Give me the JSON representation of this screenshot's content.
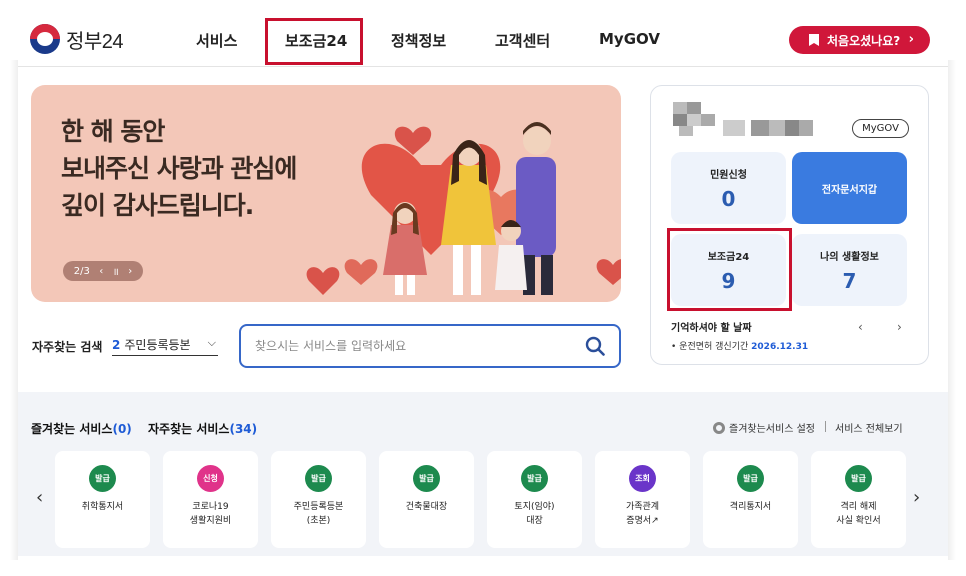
{
  "header": {
    "logo_text": "정부24",
    "nav": [
      "서비스",
      "보조금24",
      "정책정보",
      "고객센터",
      "MyGOV"
    ],
    "cta_label": "처음오셨나요?",
    "cta_arrow": "›"
  },
  "banner": {
    "title": "한 해 동안\n보내주신 사랑과 관심에\n깊이 감사드립니다.",
    "counter": "2/3",
    "prev": "‹",
    "pause": "॥",
    "next": "›",
    "bg_color": "#f3c7b8"
  },
  "search": {
    "freq_label": "자주찾는 검색",
    "freq_num": "2",
    "freq_value": "주민등록등본",
    "chevron": "⌵",
    "placeholder": "찾으시는 서비스를 입력하세요"
  },
  "panel": {
    "mygov_label": "MyGOV",
    "tiles": [
      {
        "label": "민원신청",
        "value": "0"
      },
      {
        "label": "전자문서지갑",
        "value": ""
      },
      {
        "label": "보조금24",
        "value": "9"
      },
      {
        "label": "나의 생활정보",
        "value": "7"
      }
    ],
    "remember_title": "기억하셔야 할 날짜",
    "remember_item": "운전면허 갱신기간",
    "remember_date": "2026.12.31",
    "prev": "‹",
    "next": "›"
  },
  "services": {
    "fav_label": "즐겨찾는 서비스",
    "fav_count": "(0)",
    "freq_label": "자주찾는 서비스",
    "freq_count": "(34)",
    "settings_label": "즐겨찾는서비스 설정",
    "all_label": "서비스 전체보기",
    "prev": "‹",
    "next": "›",
    "cards": [
      {
        "badge": "발급",
        "color": "#1d8a4e",
        "name": "취학통지서"
      },
      {
        "badge": "신청",
        "color": "#e0338a",
        "name": "코로나19\n생활지원비"
      },
      {
        "badge": "발급",
        "color": "#1d8a4e",
        "name": "주민등록등본\n(초본)"
      },
      {
        "badge": "발급",
        "color": "#1d8a4e",
        "name": "건축물대장"
      },
      {
        "badge": "발급",
        "color": "#1d8a4e",
        "name": "토지(임야)\n대장"
      },
      {
        "badge": "조회",
        "color": "#6a35c9",
        "name": "가족관계\n증명서↗"
      },
      {
        "badge": "발급",
        "color": "#1d8a4e",
        "name": "격리통지서"
      },
      {
        "badge": "발급",
        "color": "#1d8a4e",
        "name": "격리 해제\n사실 확인서"
      }
    ]
  }
}
